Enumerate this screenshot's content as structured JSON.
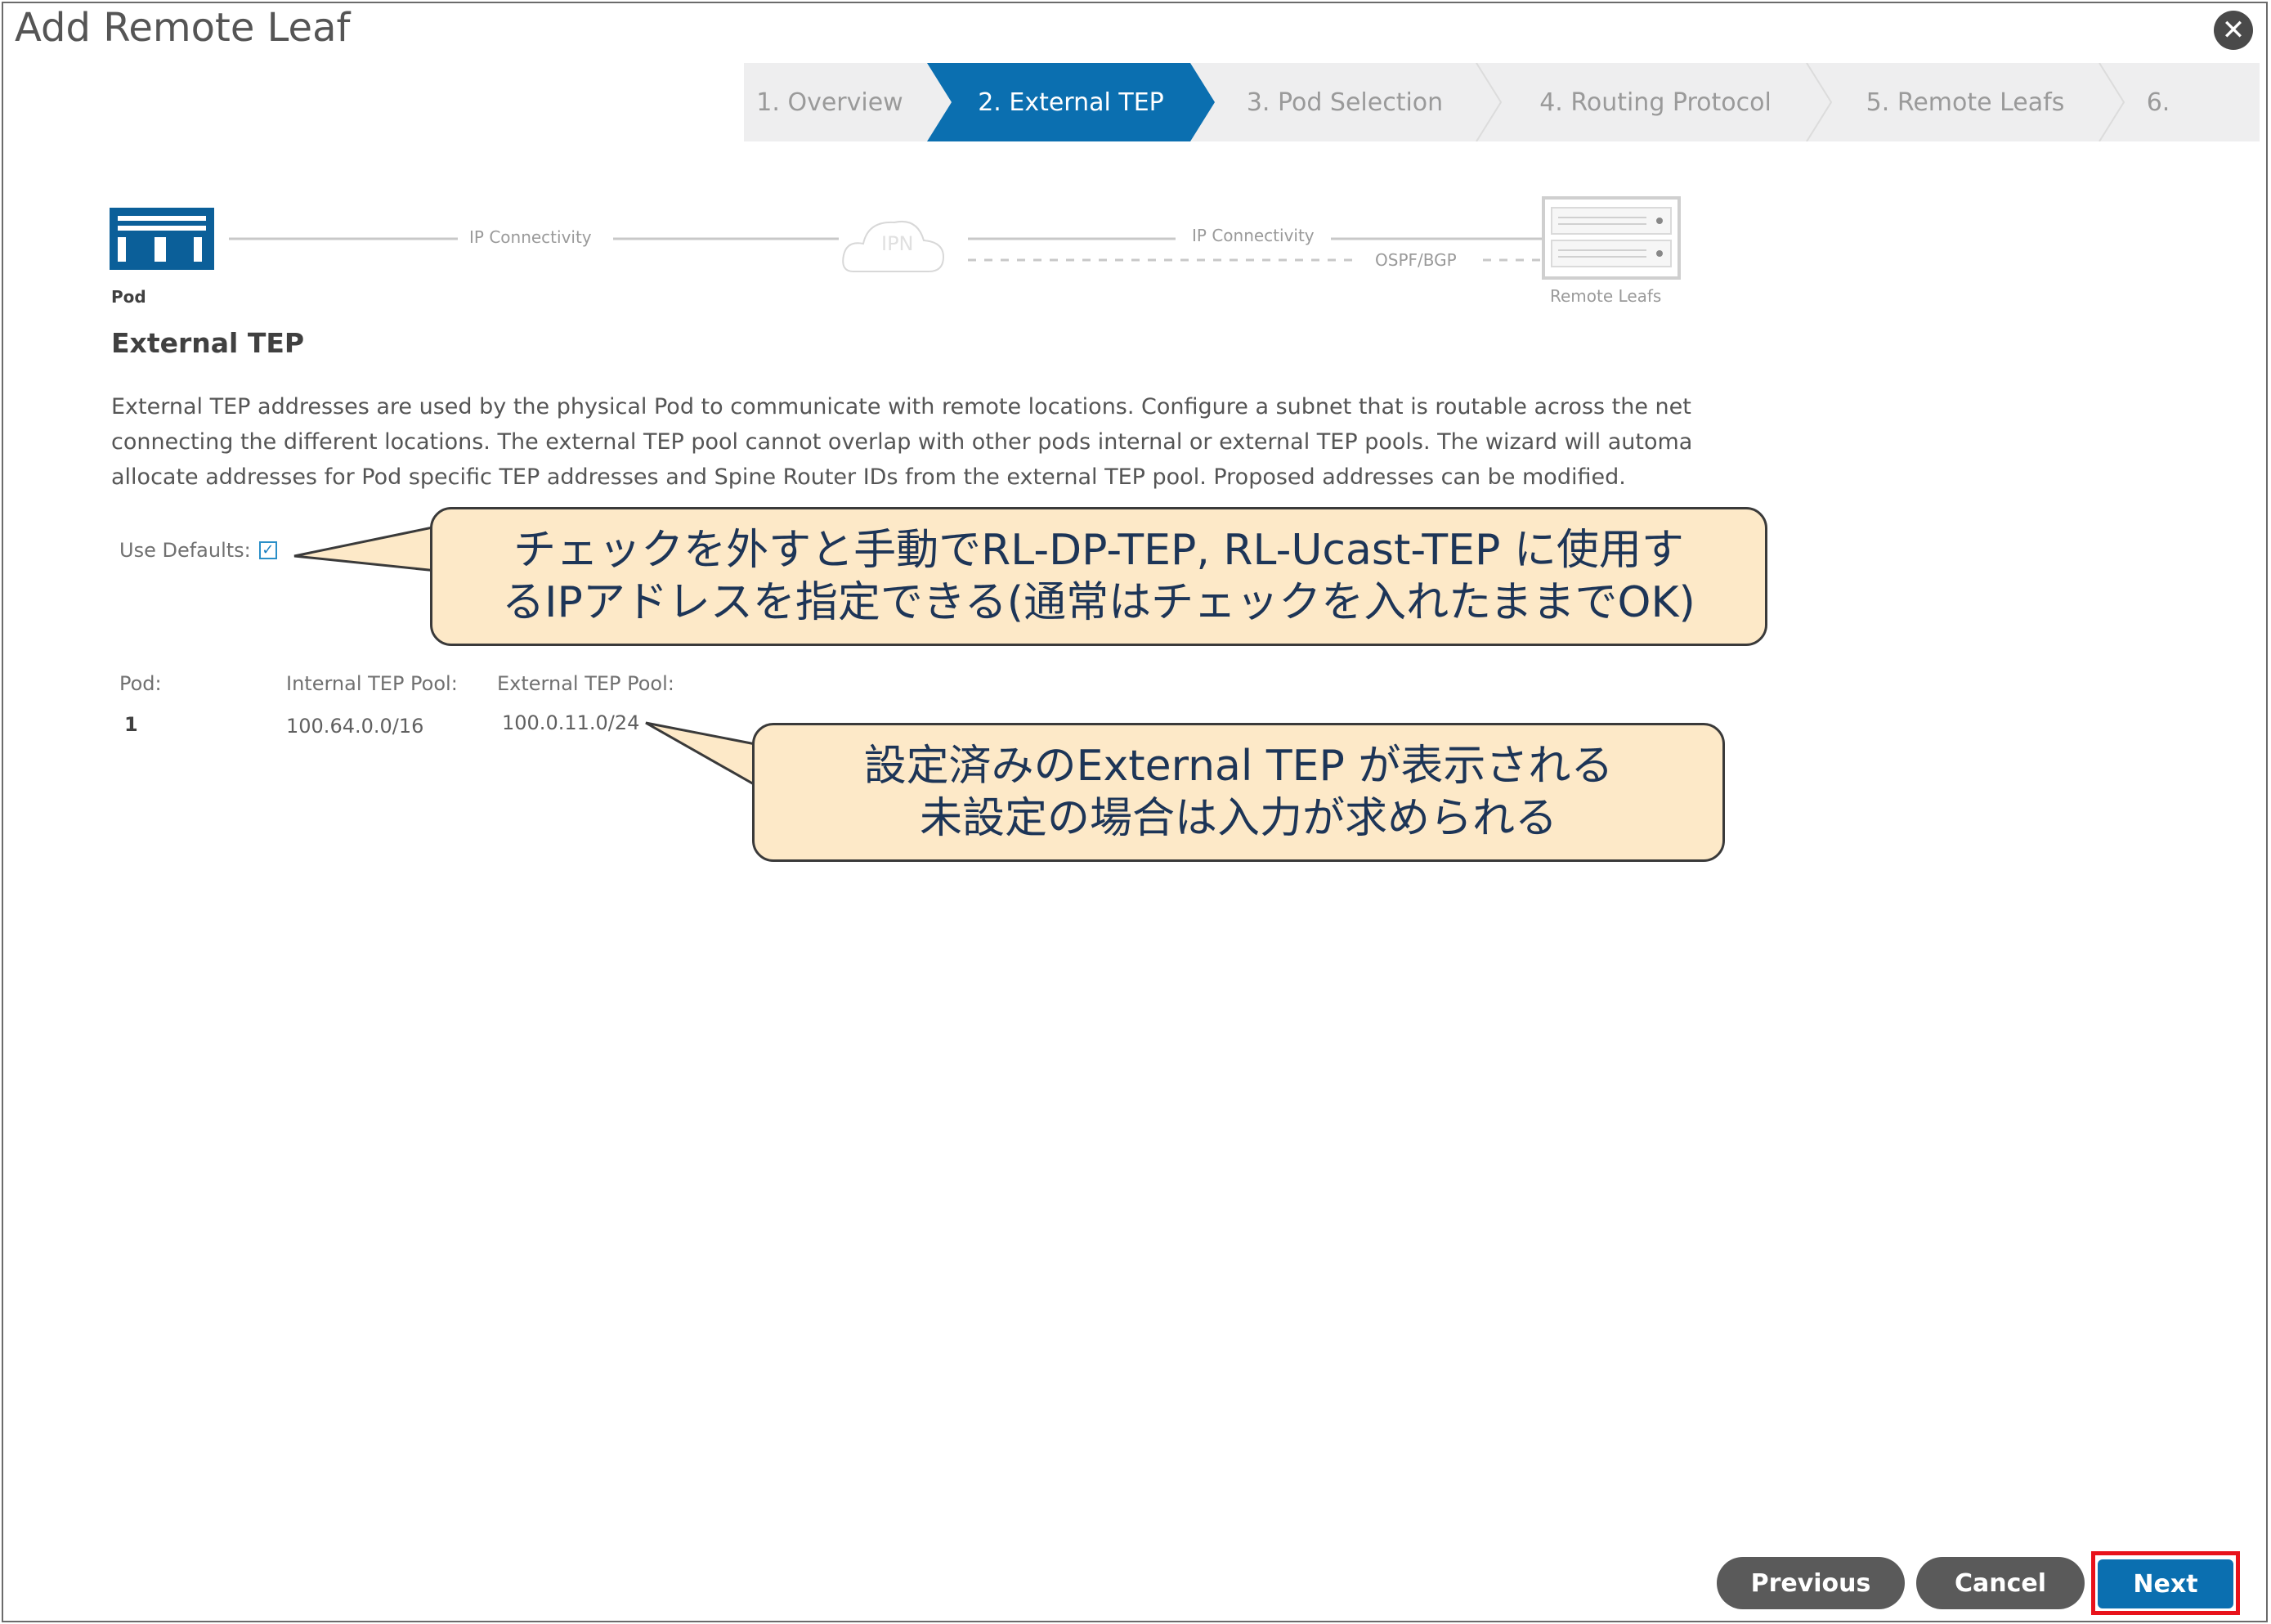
{
  "dialog": {
    "title": "Add Remote Leaf",
    "close_icon": "close-icon"
  },
  "wizard": {
    "steps": [
      {
        "label": "1. Overview",
        "active": false
      },
      {
        "label": "2. External TEP",
        "active": true
      },
      {
        "label": "3. Pod Selection",
        "active": false
      },
      {
        "label": "4. Routing Protocol",
        "active": false
      },
      {
        "label": "5. Remote Leafs",
        "active": false
      },
      {
        "label": "6.",
        "active": false
      }
    ],
    "active_color": "#0b6fb0"
  },
  "topology": {
    "pod_label": "Pod",
    "ip_connectivity_1": "IP Connectivity",
    "ipn_label": "IPN",
    "ip_connectivity_2": "IP Connectivity",
    "ospf_bgp": "OSPF/BGP",
    "remote_leafs_label": "Remote Leafs"
  },
  "main": {
    "section_title": "External TEP",
    "description_lines": [
      "External TEP addresses are used by the physical Pod to communicate with remote locations. Configure a subnet that is routable across the net",
      "connecting the different locations. The external TEP pool cannot overlap with other pods internal or external TEP pools. The wizard will automa",
      "allocate addresses for Pod specific TEP addresses and Spine Router IDs from the external TEP pool. Proposed addresses can be modified."
    ],
    "use_defaults_label": "Use Defaults:",
    "use_defaults_checked": true,
    "table": {
      "headers": [
        "Pod:",
        "Internal TEP Pool:",
        "External TEP Pool:"
      ],
      "rows": [
        [
          "1",
          "100.64.0.0/16",
          "100.0.11.0/24"
        ]
      ]
    }
  },
  "callouts": {
    "use_defaults_note": [
      "チェックを外すと手動でRL-DP-TEP, RL-Ucast-TEP に使用す",
      "るIPアドレスを指定できる(通常はチェックを入れたままでOK)"
    ],
    "external_tep_note": [
      "設定済みのExternal TEP が表示される",
      "未設定の場合は入力が求められる"
    ],
    "callout_fill": "#fde9c8"
  },
  "footer": {
    "previous_label": "Previous",
    "cancel_label": "Cancel",
    "next_label": "Next",
    "highlight_color": "#e8121b"
  }
}
